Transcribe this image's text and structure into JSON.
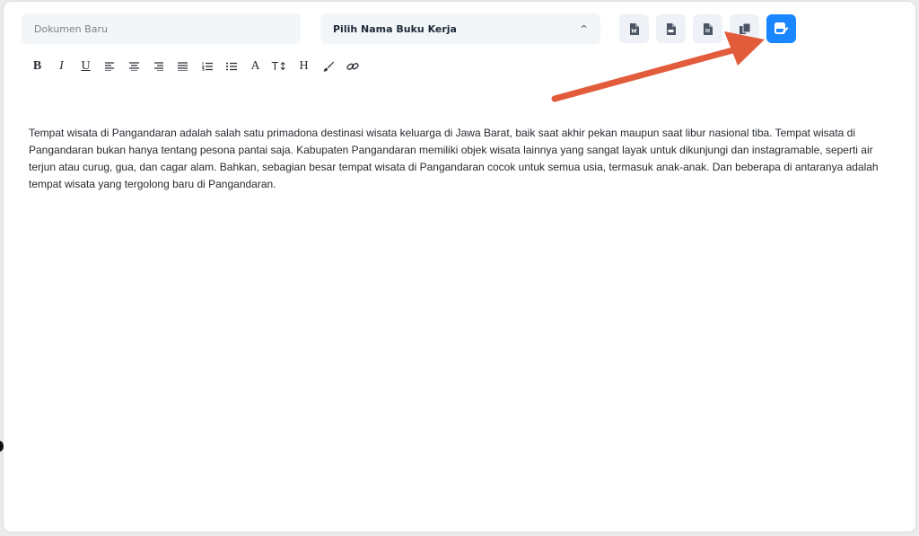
{
  "document": {
    "name_placeholder": "Dokumen Baru",
    "workbook_select_label": "Pilih Nama Buku Kerja",
    "body_text": "Tempat wisata di Pangandaran adalah salah satu primadona destinasi wisata keluarga di Jawa Barat, baik saat akhir pekan maupun saat libur nasional tiba. Tempat wisata di Pangandaran bukan hanya tentang pesona pantai saja. Kabupaten Pangandaran memiliki objek wisata lainnya yang sangat layak untuk dikunjungi dan instagramable, seperti air terjun atau curug, gua, dan cagar alam. Bahkan, sebagian besar tempat wisata di Pangandaran cocok untuk semua usia, termasuk anak-anak. Dan beberapa di antaranya adalah tempat wisata yang tergolong baru di Pangandaran."
  },
  "actions": [
    {
      "icon": "word-file-icon"
    },
    {
      "icon": "pdf-file-icon"
    },
    {
      "icon": "text-file-icon"
    },
    {
      "icon": "copy-icon"
    },
    {
      "icon": "save-icon",
      "primary": true
    }
  ],
  "toolbar": {
    "bold": "B",
    "italic": "I",
    "underline": "U",
    "font_color": "A",
    "font_size": "T↕",
    "heading": "H"
  },
  "colors": {
    "primary": "#1a86ff",
    "arrow": "#e25c3c",
    "input_bg": "#f3f6f9",
    "action_bg": "#eef1f5"
  }
}
